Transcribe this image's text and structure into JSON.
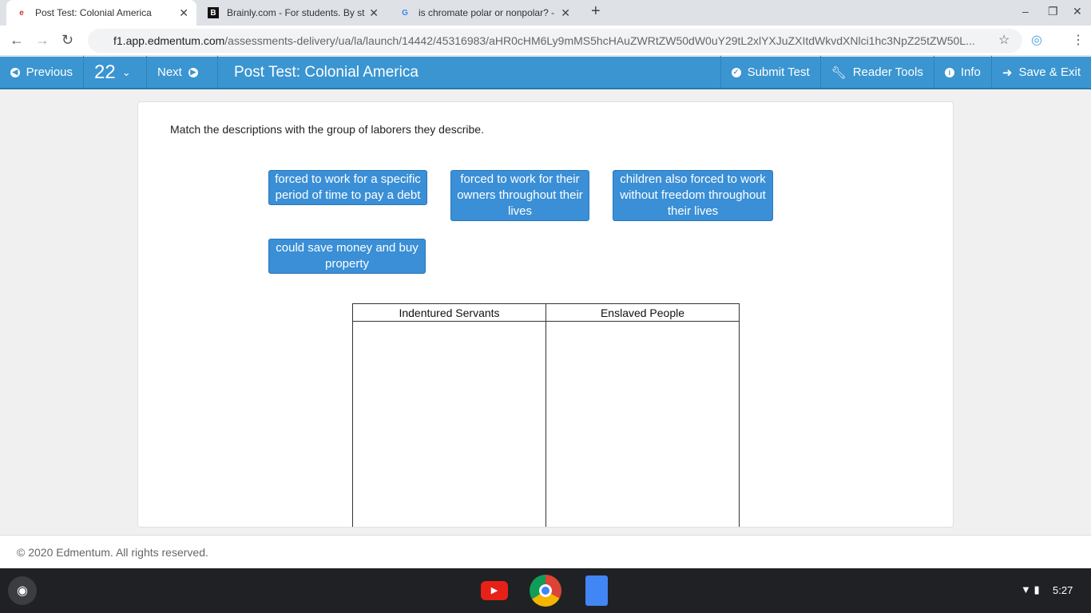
{
  "browser": {
    "tabs": [
      {
        "title": "Post Test: Colonial America",
        "active": true
      },
      {
        "title": "Brainly.com - For students. By st"
      },
      {
        "title": "is chromate polar or nonpolar? -"
      }
    ],
    "url_host": "f1.app.edmentum.com",
    "url_path": "/assessments-delivery/ua/la/launch/14442/45316983/aHR0cHM6Ly9mMS5hcHAuZWRtZW50dW0uY29tL2xlYXJuZXItdWkvdXNlci1hc3NpZ25tZW50L..."
  },
  "toolbar": {
    "previous": "Previous",
    "question_number": "22",
    "next": "Next",
    "title": "Post Test: Colonial America",
    "submit": "Submit Test",
    "reader_tools": "Reader Tools",
    "info": "Info",
    "save_exit": "Save & Exit"
  },
  "question": {
    "prompt": "Match the descriptions with the group of laborers they describe.",
    "chips": [
      "forced to work for a specific period of time to pay a debt",
      "forced to work for their owners throughout their lives",
      "children also forced to work without freedom throughout their lives",
      "could save money and buy property"
    ],
    "columns": [
      "Indentured Servants",
      "Enslaved People"
    ]
  },
  "footer": "© 2020 Edmentum. All rights reserved.",
  "shelf": {
    "time": "5:27"
  },
  "colors": {
    "accent": "#3a95d1",
    "chip": "#3a8fd6"
  }
}
